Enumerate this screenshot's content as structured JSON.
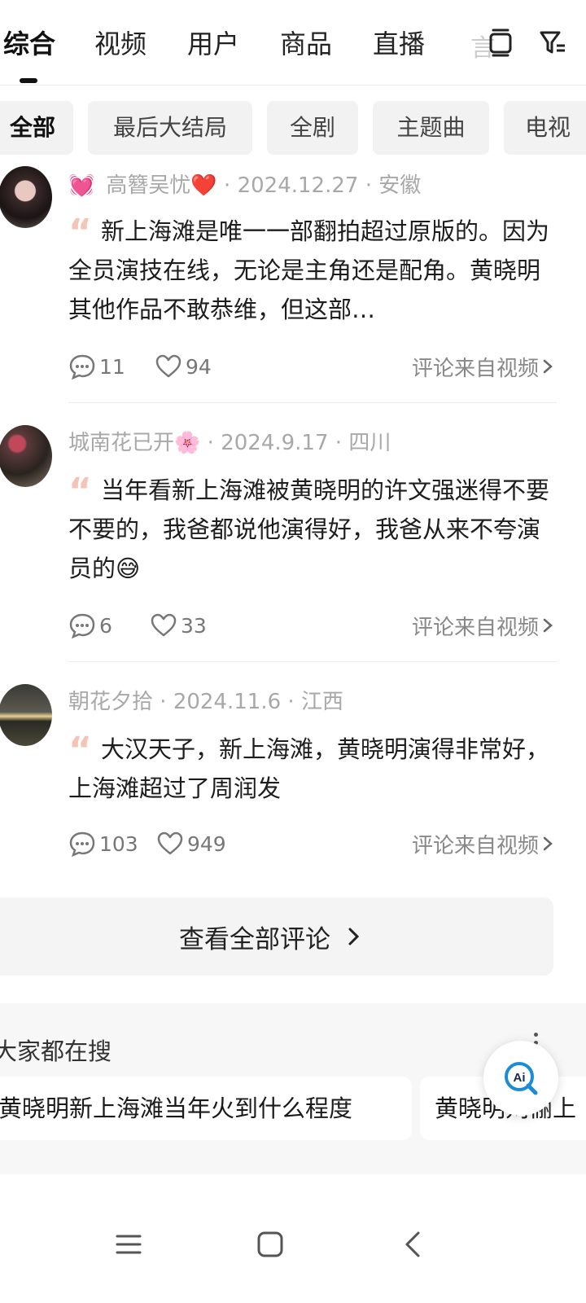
{
  "top_tabs": {
    "items": [
      "综合",
      "视频",
      "用户",
      "商品",
      "直播"
    ],
    "faded": "言",
    "active_index": 0
  },
  "chips": [
    "全部",
    "最后大结局",
    "全剧",
    "主题曲",
    "电视"
  ],
  "comments": [
    {
      "user": "高簪吴忧",
      "user_emoji": "💓",
      "user_suffix": "❤️",
      "date": "2024.12.27",
      "location": "安徽",
      "text": "新上海滩是唯一一部翻拍超过原版的。因为全员演技在线，无论是主角还是配角。黄晓明其他作品不敢恭维，但这部…",
      "replies": "11",
      "likes": "94",
      "source": "评论来自视频"
    },
    {
      "user": "城南花已开",
      "user_suffix": "🌸",
      "date": "2024.9.17",
      "location": "四川",
      "text": "当年看新上海滩被黄晓明的许文强迷得不要不要的，我爸都说他演得好，我爸从来不夸演员的😅",
      "replies": "6",
      "likes": "33",
      "source": "评论来自视频"
    },
    {
      "user": "朝花夕拾",
      "date": "2024.11.6",
      "location": "江西",
      "text": "大汉天子，新上海滩，黄晓明演得非常好，上海滩超过了周润发",
      "replies": "103",
      "likes": "949",
      "source": "评论来自视频"
    }
  ],
  "view_all": "查看全部评论",
  "suggest": {
    "title": "大家都在搜",
    "items": [
      "黄晓明新上海滩当年火到什么程度",
      "黄晓明刘俪上"
    ]
  },
  "colors": {
    "accent": "#111111",
    "quote": "#f4c4b6",
    "muted": "#a8a8a8"
  },
  "icons": [
    "reply-icon",
    "heart-icon",
    "chevron-right-icon",
    "filter-icon",
    "window-icon",
    "ai-icon",
    "menu-icon",
    "home-icon",
    "back-icon"
  ]
}
